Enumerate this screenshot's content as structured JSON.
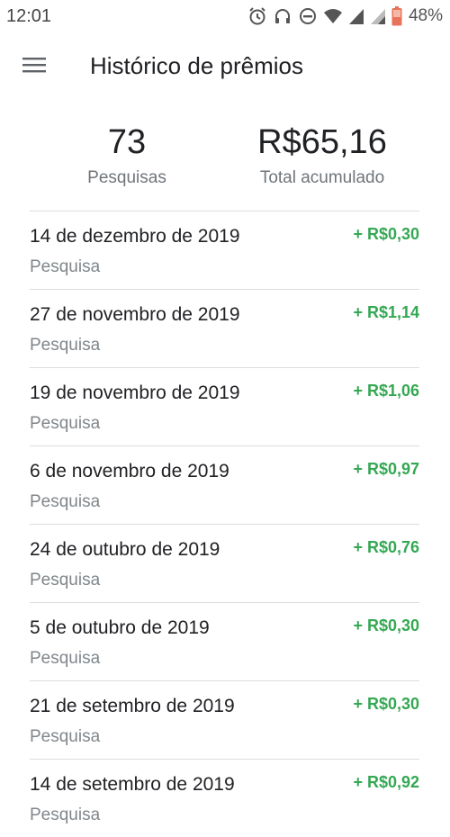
{
  "status_bar": {
    "time": "12:01",
    "battery": "48%",
    "icons": [
      "alarm-icon",
      "headset-icon",
      "do-not-disturb-icon",
      "wifi-icon",
      "signal-icon",
      "signal-icon",
      "battery-icon"
    ]
  },
  "app_bar": {
    "menu_icon": "hamburger-menu-icon",
    "title": "Histórico de prêmios"
  },
  "summary": {
    "surveys_count": "73",
    "surveys_label": "Pesquisas",
    "total_value": "R$65,16",
    "total_label": "Total acumulado"
  },
  "history": [
    {
      "date": "14 de dezembro de 2019",
      "type": "Pesquisa",
      "amount": "+ R$0,30"
    },
    {
      "date": "27 de novembro de 2019",
      "type": "Pesquisa",
      "amount": "+ R$1,14"
    },
    {
      "date": "19 de novembro de 2019",
      "type": "Pesquisa",
      "amount": "+ R$1,06"
    },
    {
      "date": "6 de novembro de 2019",
      "type": "Pesquisa",
      "amount": "+ R$0,97"
    },
    {
      "date": "24 de outubro de 2019",
      "type": "Pesquisa",
      "amount": "+ R$0,76"
    },
    {
      "date": "5 de outubro de 2019",
      "type": "Pesquisa",
      "amount": "+ R$0,30"
    },
    {
      "date": "21 de setembro de 2019",
      "type": "Pesquisa",
      "amount": "+ R$0,30"
    },
    {
      "date": "14 de setembro de 2019",
      "type": "Pesquisa",
      "amount": "+ R$0,92"
    }
  ],
  "colors": {
    "amount_green": "#34a853",
    "primary_text": "#202124",
    "secondary_text": "#80868b",
    "divider": "#dcdcdc"
  }
}
